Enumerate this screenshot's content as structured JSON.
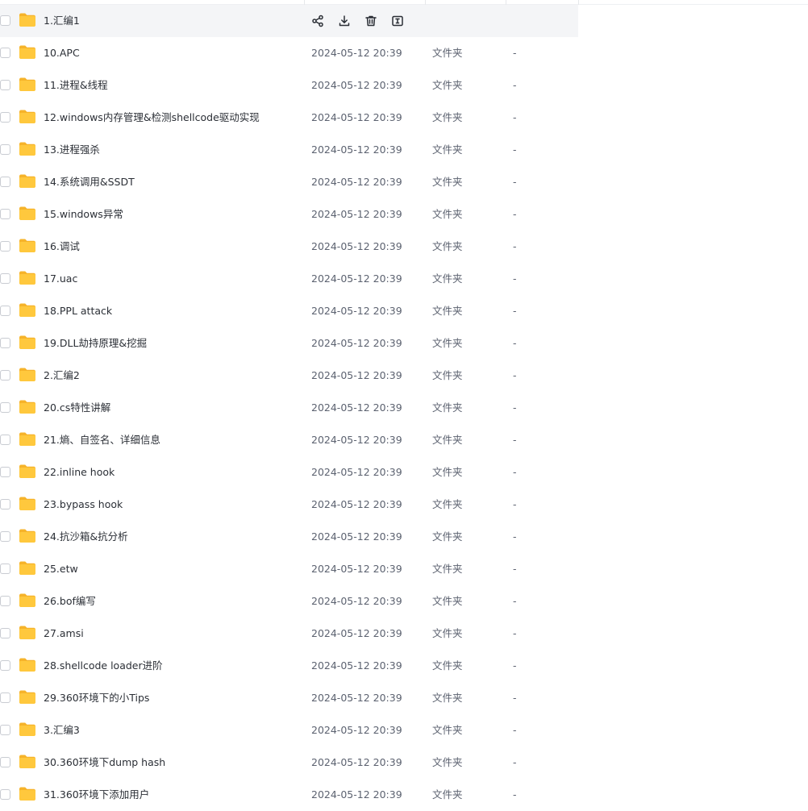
{
  "files": [
    {
      "name": "1.汇编1",
      "date": "",
      "type": "",
      "size": ""
    },
    {
      "name": "10.APC",
      "date": "2024-05-12 20:39",
      "type": "文件夹",
      "size": "-"
    },
    {
      "name": "11.进程&线程",
      "date": "2024-05-12 20:39",
      "type": "文件夹",
      "size": "-"
    },
    {
      "name": "12.windows内存管理&检测shellcode驱动实现",
      "date": "2024-05-12 20:39",
      "type": "文件夹",
      "size": "-"
    },
    {
      "name": "13.进程强杀",
      "date": "2024-05-12 20:39",
      "type": "文件夹",
      "size": "-"
    },
    {
      "name": "14.系统调用&SSDT",
      "date": "2024-05-12 20:39",
      "type": "文件夹",
      "size": "-"
    },
    {
      "name": "15.windows异常",
      "date": "2024-05-12 20:39",
      "type": "文件夹",
      "size": "-"
    },
    {
      "name": "16.调试",
      "date": "2024-05-12 20:39",
      "type": "文件夹",
      "size": "-"
    },
    {
      "name": "17.uac",
      "date": "2024-05-12 20:39",
      "type": "文件夹",
      "size": "-"
    },
    {
      "name": "18.PPL attack",
      "date": "2024-05-12 20:39",
      "type": "文件夹",
      "size": "-"
    },
    {
      "name": "19.DLL劫持原理&挖掘",
      "date": "2024-05-12 20:39",
      "type": "文件夹",
      "size": "-"
    },
    {
      "name": "2.汇编2",
      "date": "2024-05-12 20:39",
      "type": "文件夹",
      "size": "-"
    },
    {
      "name": "20.cs特性讲解",
      "date": "2024-05-12 20:39",
      "type": "文件夹",
      "size": "-"
    },
    {
      "name": "21.熵、自签名、详细信息",
      "date": "2024-05-12 20:39",
      "type": "文件夹",
      "size": "-"
    },
    {
      "name": "22.inline hook",
      "date": "2024-05-12 20:39",
      "type": "文件夹",
      "size": "-"
    },
    {
      "name": "23.bypass hook",
      "date": "2024-05-12 20:39",
      "type": "文件夹",
      "size": "-"
    },
    {
      "name": "24.抗沙箱&抗分析",
      "date": "2024-05-12 20:39",
      "type": "文件夹",
      "size": "-"
    },
    {
      "name": "25.etw",
      "date": "2024-05-12 20:39",
      "type": "文件夹",
      "size": "-"
    },
    {
      "name": "26.bof编写",
      "date": "2024-05-12 20:39",
      "type": "文件夹",
      "size": "-"
    },
    {
      "name": "27.amsi",
      "date": "2024-05-12 20:39",
      "type": "文件夹",
      "size": "-"
    },
    {
      "name": "28.shellcode loader进阶",
      "date": "2024-05-12 20:39",
      "type": "文件夹",
      "size": "-"
    },
    {
      "name": "29.360环境下的小Tips",
      "date": "2024-05-12 20:39",
      "type": "文件夹",
      "size": "-"
    },
    {
      "name": "3.汇编3",
      "date": "2024-05-12 20:39",
      "type": "文件夹",
      "size": "-"
    },
    {
      "name": "30.360环境下dump hash",
      "date": "2024-05-12 20:39",
      "type": "文件夹",
      "size": "-"
    },
    {
      "name": "31.360环境下添加用户",
      "date": "2024-05-12 20:39",
      "type": "文件夹",
      "size": "-"
    }
  ],
  "hover_actions": [
    "share-icon",
    "download-icon",
    "delete-icon",
    "rename-icon"
  ],
  "colors": {
    "folder": "#ffc83d",
    "hover_row": "#f4f5f7",
    "text": "#2b2f36",
    "secondary_text": "#5c6270"
  }
}
